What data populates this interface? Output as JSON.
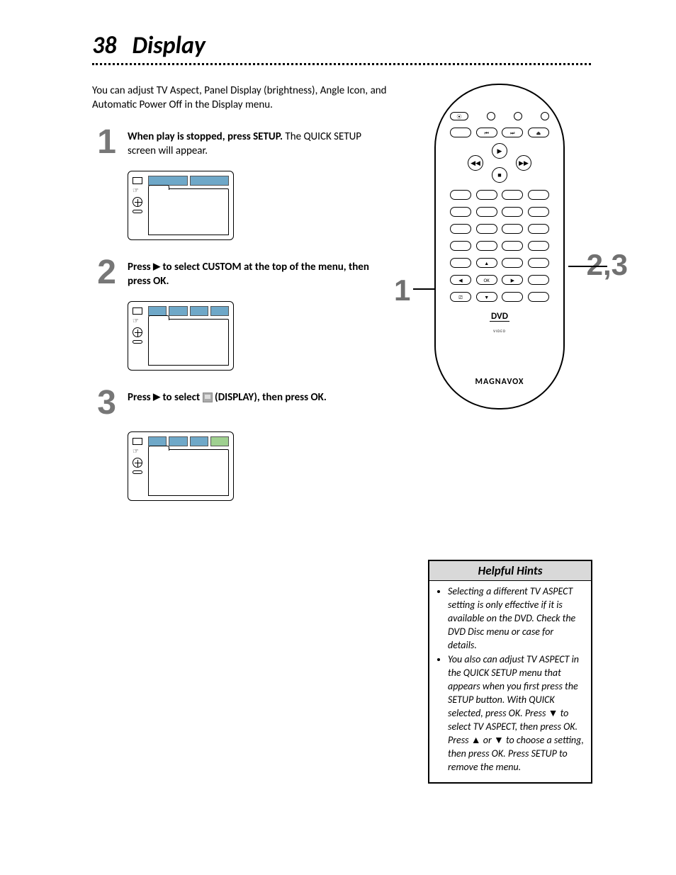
{
  "header": {
    "page_number": "38",
    "title": "Display"
  },
  "intro": "You can adjust TV Aspect, Panel Display (brightness), Angle Icon, and Automatic Power Off in the Display menu.",
  "steps": {
    "s1": {
      "num": "1",
      "bold": "When play is stopped, press SETUP.",
      "rest": " The QUICK SETUP screen will appear."
    },
    "s2": {
      "num": "2",
      "pre": "Press ",
      "mid": " to select CUSTOM at the top of the menu, then press OK."
    },
    "s3": {
      "num": "3",
      "pre": "Press ",
      "mid": " to select ",
      "post": " (DISPLAY), then press OK."
    }
  },
  "remote": {
    "brand": "MAGNAVOX",
    "dvd": "DVD",
    "dvd_sub": "VIDEO",
    "callout_left": "1",
    "callout_right": "2,3"
  },
  "hints": {
    "title": "Helpful Hints",
    "h1": "Selecting a different TV ASPECT setting is only effective if it is available on the DVD. Check the DVD Disc menu or case for details.",
    "h2": "You also can adjust TV ASPECT in the QUICK SETUP menu that appears when you first press the SETUP button. With QUICK selected, press OK. Press ▼ to select TV ASPECT, then press OK. Press ▲ or ▼ to choose a setting, then press OK. Press SETUP to remove the menu."
  }
}
